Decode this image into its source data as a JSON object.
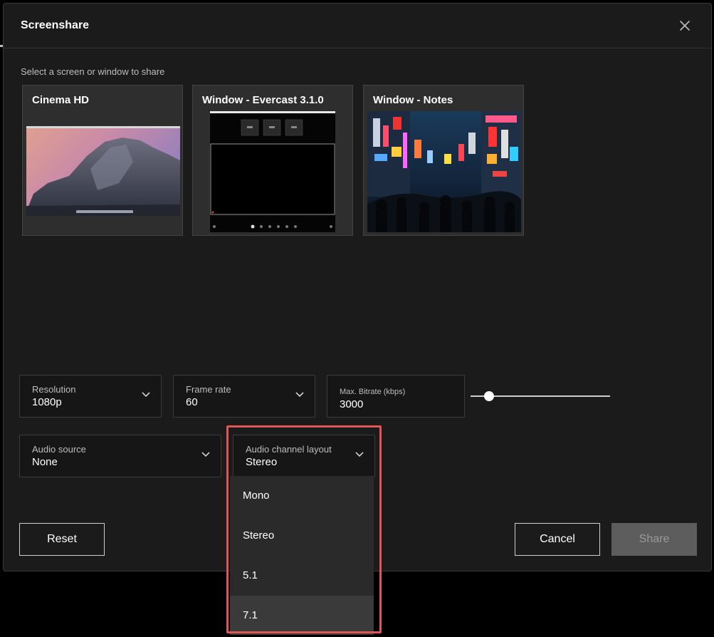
{
  "dialog": {
    "title": "Screenshare",
    "subtitle": "Select a screen or window to share"
  },
  "sources": [
    {
      "label": "Cinema HD"
    },
    {
      "label": "Window - Evercast 3.1.0"
    },
    {
      "label": "Window - Notes"
    }
  ],
  "settings": {
    "resolution": {
      "label": "Resolution",
      "value": "1080p"
    },
    "frame_rate": {
      "label": "Frame rate",
      "value": "60"
    },
    "bitrate": {
      "label": "Max. Bitrate (kbps)",
      "value": "3000",
      "slider_fraction": 0.1
    },
    "audio_source": {
      "label": "Audio source",
      "value": "None"
    },
    "audio_channel_layout": {
      "label": "Audio channel layout",
      "value": "Stereo"
    }
  },
  "dropdown": {
    "options": [
      "Mono",
      "Stereo",
      "5.1",
      "7.1"
    ],
    "hovered": "7.1"
  },
  "buttons": {
    "reset": "Reset",
    "cancel": "Cancel",
    "share": "Share"
  },
  "icons": {
    "close": "close-icon",
    "chevron": "chevron-down-icon"
  },
  "colors": {
    "highlight": "#e05555",
    "background": "#1b1b1b"
  }
}
